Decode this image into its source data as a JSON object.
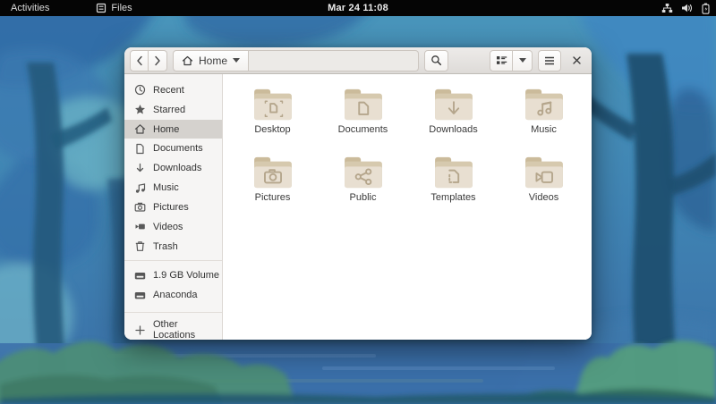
{
  "topbar": {
    "activities_label": "Activities",
    "app_menu_label": "Files",
    "clock": "Mar 24 11:08",
    "status_icons": [
      "network-icon",
      "volume-icon",
      "battery-icon"
    ]
  },
  "headerbar": {
    "path_label": "Home",
    "icons": [
      "back-icon",
      "forward-icon",
      "home-icon",
      "search-icon",
      "grid-view-icon",
      "view-dropdown-icon",
      "hamburger-menu-icon",
      "close-icon"
    ]
  },
  "sidebar": {
    "items": [
      {
        "label": "Recent",
        "icon": "recent-icon",
        "selected": false
      },
      {
        "label": "Starred",
        "icon": "star-icon",
        "selected": false
      },
      {
        "label": "Home",
        "icon": "home-icon",
        "selected": true
      },
      {
        "label": "Documents",
        "icon": "document-icon",
        "selected": false
      },
      {
        "label": "Downloads",
        "icon": "download-icon",
        "selected": false
      },
      {
        "label": "Music",
        "icon": "music-icon",
        "selected": false
      },
      {
        "label": "Pictures",
        "icon": "camera-icon",
        "selected": false
      },
      {
        "label": "Videos",
        "icon": "video-icon",
        "selected": false
      },
      {
        "label": "Trash",
        "icon": "trash-icon",
        "selected": false
      }
    ],
    "devices": [
      {
        "label": "1.9 GB Volume",
        "icon": "drive-icon"
      },
      {
        "label": "Anaconda",
        "icon": "drive-icon"
      }
    ],
    "other_locations_label": "Other Locations"
  },
  "folders": [
    {
      "name": "Desktop",
      "emblem": "desktop-emblem"
    },
    {
      "name": "Documents",
      "emblem": "document-emblem"
    },
    {
      "name": "Downloads",
      "emblem": "download-emblem"
    },
    {
      "name": "Music",
      "emblem": "music-emblem"
    },
    {
      "name": "Pictures",
      "emblem": "camera-emblem"
    },
    {
      "name": "Public",
      "emblem": "share-emblem"
    },
    {
      "name": "Templates",
      "emblem": "template-emblem"
    },
    {
      "name": "Videos",
      "emblem": "video-emblem"
    }
  ],
  "colors": {
    "folder_tab": "#cbbb9b",
    "folder_back": "#d6c9ae",
    "folder_front": "#e8dfd1",
    "folder_emblem": "#b5a68c",
    "sidebar_selected": "#d5d2ce",
    "topbar_bg": "#050505",
    "headerbar_top": "#edebe9",
    "headerbar_bottom": "#dedbd8"
  }
}
